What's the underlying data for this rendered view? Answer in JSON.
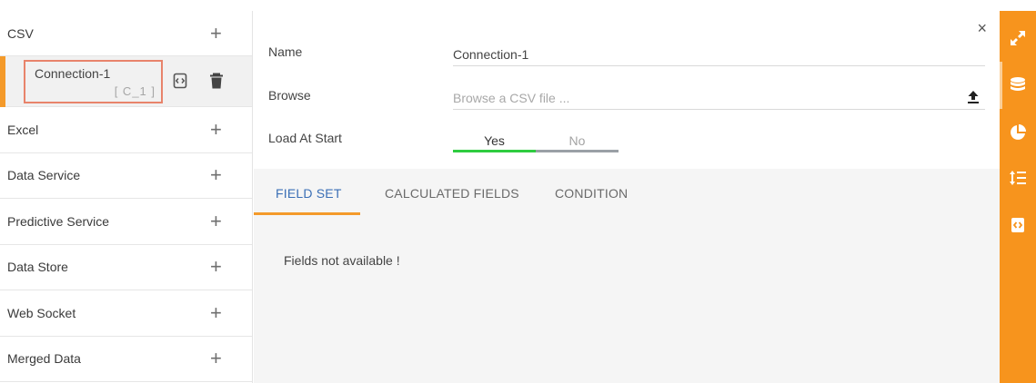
{
  "sidebar": {
    "top_item": {
      "label": "CSV"
    },
    "connection": {
      "name": "Connection-1",
      "code": "[ C_1 ]"
    },
    "items": [
      {
        "label": "Excel"
      },
      {
        "label": "Data Service"
      },
      {
        "label": "Predictive Service"
      },
      {
        "label": "Data Store"
      },
      {
        "label": "Web Socket"
      },
      {
        "label": "Merged Data"
      }
    ],
    "add_symbol": "+"
  },
  "form": {
    "close_symbol": "×",
    "name_label": "Name",
    "name_value": "Connection-1",
    "browse_label": "Browse",
    "browse_placeholder": "Browse a CSV file ...",
    "load_label": "Load At Start",
    "toggle_yes": "Yes",
    "toggle_no": "No",
    "toggle_selected": "Yes"
  },
  "tabs": {
    "items": [
      "FIELD SET",
      "CALCULATED FIELDS",
      "CONDITION"
    ],
    "active": "FIELD SET",
    "empty_message": "Fields not available !"
  },
  "rail": {
    "icons": [
      "expand-icon",
      "database-icon",
      "pie-chart-icon",
      "sort-icon",
      "script-icon"
    ],
    "active": "database-icon"
  },
  "colors": {
    "accent": "#f7941d",
    "highlight_border": "#e8836b",
    "toggle_on": "#2ecc40",
    "tab_active": "#3b6fb6"
  }
}
